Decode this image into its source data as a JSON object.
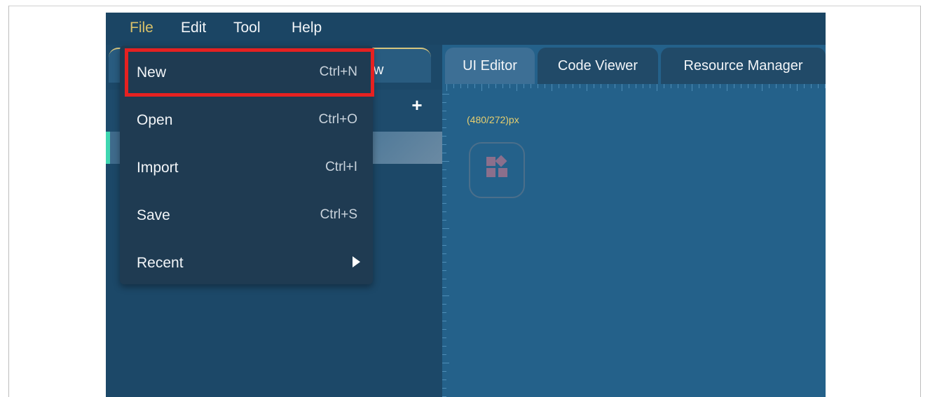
{
  "menubar": {
    "items": [
      {
        "label": "File",
        "active": true
      },
      {
        "label": "Edit",
        "active": false
      },
      {
        "label": "Tool",
        "active": false
      },
      {
        "label": "Help",
        "active": false
      }
    ]
  },
  "left_panel": {
    "tab_label": "w",
    "add_icon": "plus-icon"
  },
  "tabs": [
    {
      "label": "UI Editor",
      "active": true
    },
    {
      "label": "Code Viewer",
      "active": false
    },
    {
      "label": "Resource Manager",
      "active": false
    }
  ],
  "canvas": {
    "resolution_label": "(480/272)px",
    "widget_icon": "widgets-icon"
  },
  "file_menu": {
    "items": [
      {
        "label": "New",
        "shortcut": "Ctrl+N"
      },
      {
        "label": "Open",
        "shortcut": "Ctrl+O"
      },
      {
        "label": "Import",
        "shortcut": "Ctrl+I"
      },
      {
        "label": "Save",
        "shortcut": "Ctrl+S"
      },
      {
        "label": "Recent",
        "submenu_icon": "submenu-arrow-icon"
      }
    ]
  },
  "colors": {
    "menu_active": "#d9c16a",
    "highlight": "#e62121",
    "accent": "#3fd6b0",
    "resolution_label": "#e7cf6f"
  }
}
